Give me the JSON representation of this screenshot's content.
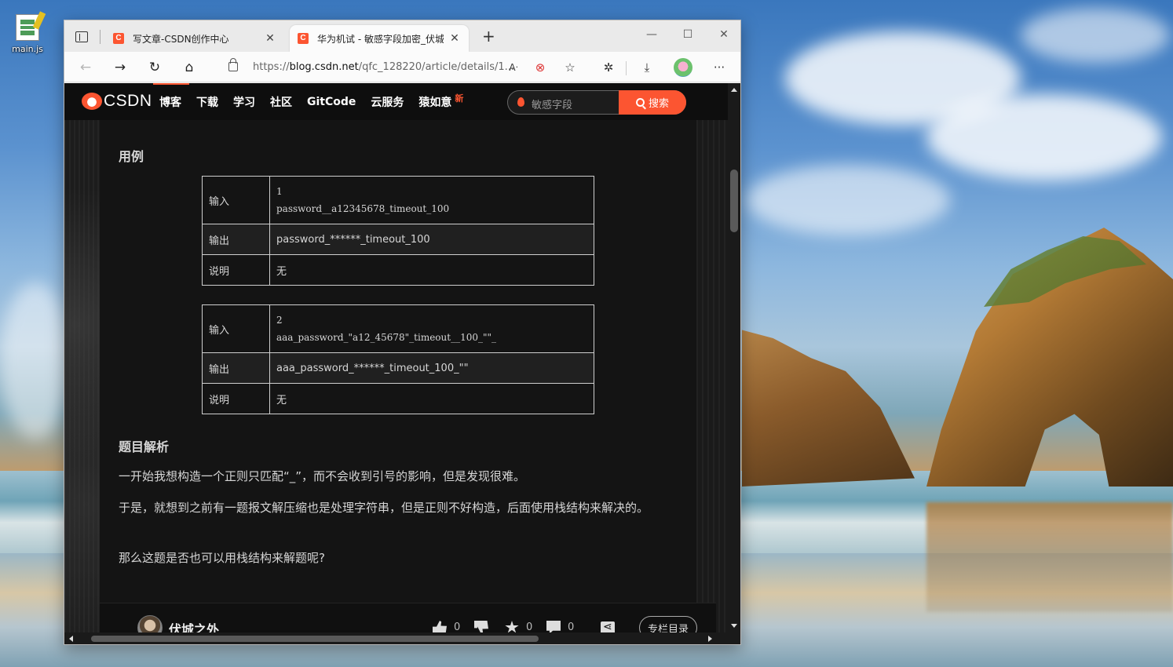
{
  "desktop": {
    "icon_label": "main.js"
  },
  "browser": {
    "tabs": [
      {
        "title": "写文章-CSDN创作中心",
        "favicon": "C"
      },
      {
        "title": "华为机试 - 敏感字段加密_伏城之",
        "favicon": "C"
      }
    ],
    "url_scheme": "https://",
    "url_host": "blog.csdn.net",
    "url_path": "/qfc_128220/article/details/1...",
    "new_tab_glyph": "+",
    "window_controls": {
      "minimize": "—",
      "maximize": "☐",
      "close": "✕"
    },
    "toolbar_glyphs": {
      "back": "←",
      "forward": "→",
      "refresh": "↻",
      "home": "⌂",
      "read_aloud": "Aᐧ",
      "tracking": "⊗",
      "favorites": "☆",
      "extensions": "✲",
      "downloads": "⤓",
      "more": "···"
    }
  },
  "csdn": {
    "logo": "CSDN",
    "nav": [
      "博客",
      "下载",
      "学习",
      "社区",
      "GitCode",
      "云服务",
      "猿如意"
    ],
    "new_badge": "新",
    "search_placeholder": "敏感字段",
    "search_button": "搜索"
  },
  "article": {
    "section_example": "用例",
    "tables": [
      {
        "rows": [
          {
            "key": "输入",
            "lines": [
              "1",
              "password__a12345678_timeout_100"
            ],
            "mono": true
          },
          {
            "key": "输出",
            "lines": [
              "password_******_timeout_100"
            ],
            "mono": false
          },
          {
            "key": "说明",
            "lines": [
              "无"
            ],
            "mono": false
          }
        ]
      },
      {
        "rows": [
          {
            "key": "输入",
            "lines": [
              "2",
              "aaa_password_\"a12_45678\"_timeout__100_\"\"_"
            ],
            "mono": true
          },
          {
            "key": "输出",
            "lines": [
              "aaa_password_******_timeout_100_\"\""
            ],
            "mono": false
          },
          {
            "key": "说明",
            "lines": [
              "无"
            ],
            "mono": false
          }
        ]
      }
    ],
    "section_analysis": "题目解析",
    "paragraphs": [
      "一开始我想构造一个正则只匹配“_”，而不会收到引号的影响，但是发现很难。",
      "于是，就想到之前有一题报文解压缩也是处理字符串，但是正则不好构造，后面使用栈结构来解决的。",
      "那么这题是否也可以用栈结构来解题呢?"
    ]
  },
  "bottom_bar": {
    "author": "伏城之外",
    "like_count": "0",
    "favorite_count": "0",
    "comment_count": "0",
    "column_button": "专栏目录"
  }
}
